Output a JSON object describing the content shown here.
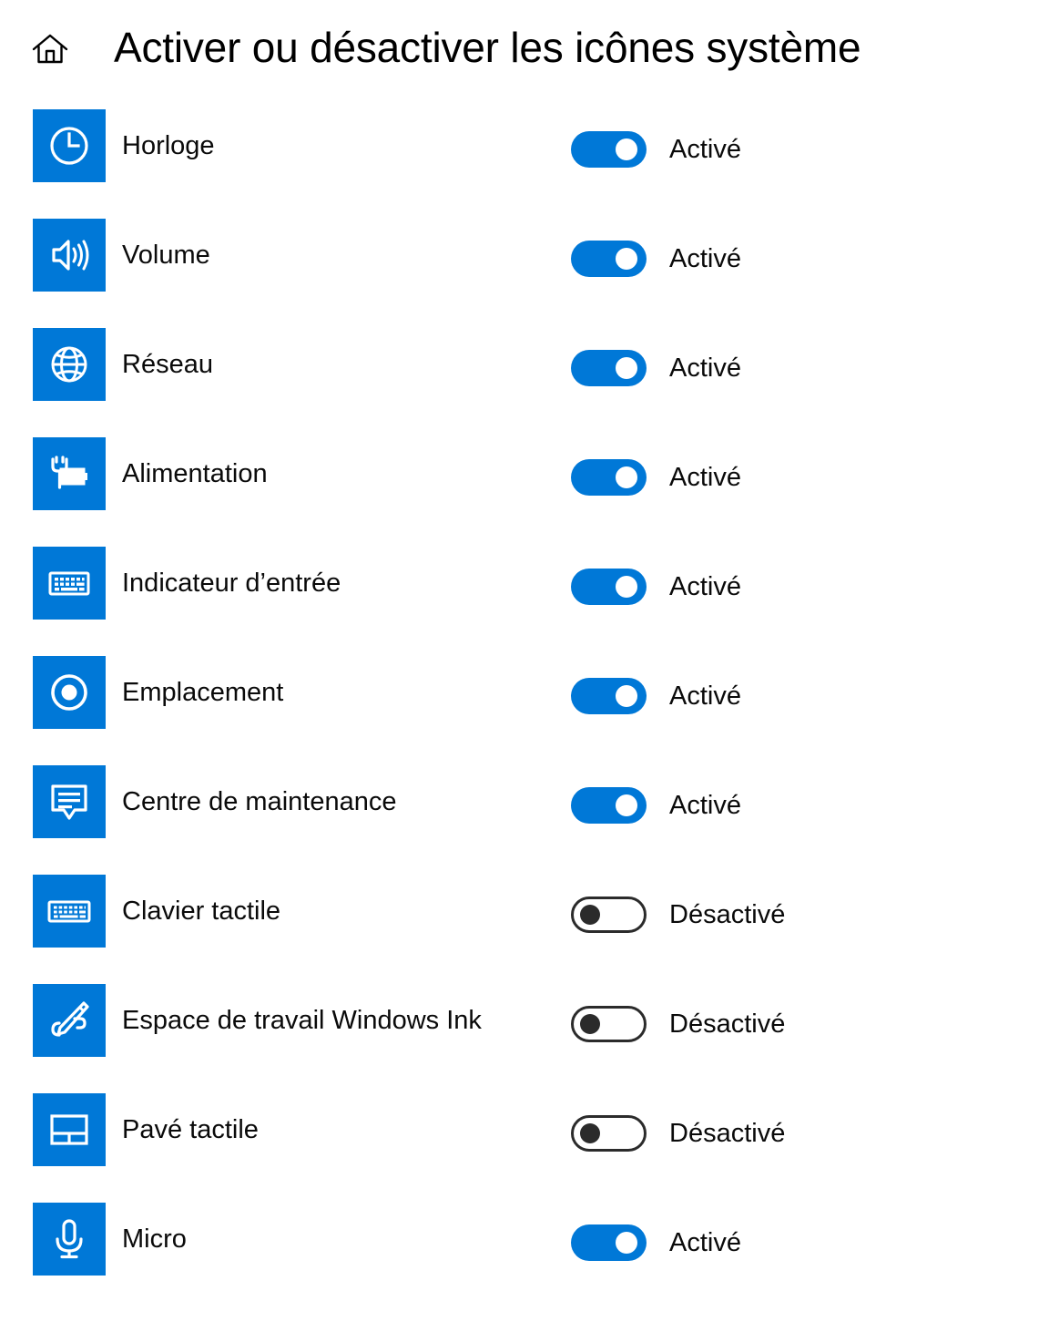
{
  "header": {
    "home_icon": "home-icon",
    "title": "Activer ou désactiver les icônes système"
  },
  "states": {
    "on": "Activé",
    "off": "Désactivé"
  },
  "rows": [
    {
      "icon": "clock-icon",
      "label": "Horloge",
      "state": "Activé",
      "on": true
    },
    {
      "icon": "volume-icon",
      "label": "Volume",
      "state": "Activé",
      "on": true
    },
    {
      "icon": "network-globe-icon",
      "label": "Réseau",
      "state": "Activé",
      "on": true
    },
    {
      "icon": "power-battery-icon",
      "label": "Alimentation",
      "state": "Activé",
      "on": true
    },
    {
      "icon": "input-keyboard-icon",
      "label": "Indicateur d’entrée",
      "state": "Activé",
      "on": true
    },
    {
      "icon": "location-icon",
      "label": "Emplacement",
      "state": "Activé",
      "on": true
    },
    {
      "icon": "action-center-icon",
      "label": "Centre de maintenance",
      "state": "Activé",
      "on": true
    },
    {
      "icon": "touch-keyboard-icon",
      "label": "Clavier tactile",
      "state": "Désactivé",
      "on": false
    },
    {
      "icon": "windows-ink-pen-icon",
      "label": "Espace de travail Windows Ink",
      "state": "Désactivé",
      "on": false
    },
    {
      "icon": "touchpad-icon",
      "label": "Pavé tactile",
      "state": "Désactivé",
      "on": false
    },
    {
      "icon": "microphone-icon",
      "label": "Micro",
      "state": "Activé",
      "on": true
    }
  ],
  "colors": {
    "tile_blue": "#0078d7",
    "toggle_on": "#0078d7",
    "toggle_off_border": "#2b2b2b",
    "text": "#0a0a0a",
    "background": "#ffffff"
  }
}
